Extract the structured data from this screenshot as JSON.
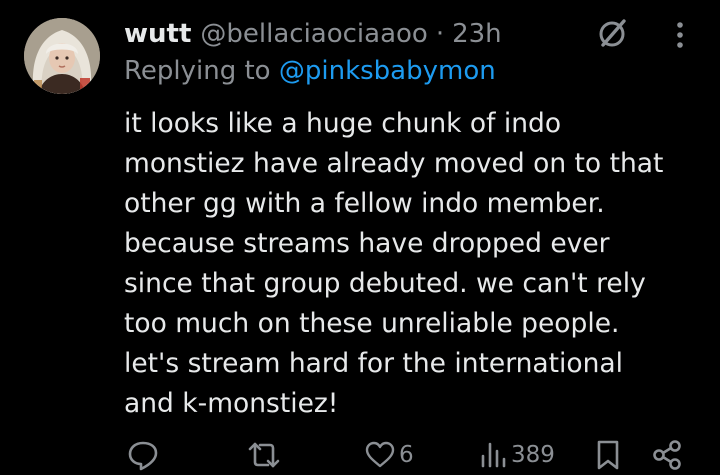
{
  "tweet": {
    "author": {
      "display_name": "wutt",
      "handle": "@bellaciaociaaoo",
      "separator": "·",
      "time": "23h",
      "avatar_icon": "profile-photo"
    },
    "reply": {
      "prefix": "Replying to",
      "mention": "@pinksbabymon"
    },
    "text_lines": [
      "it looks like a huge chunk of indo",
      "monstiez have already moved on to that",
      "other gg with a fellow indo member.",
      "because streams have dropped ever",
      "since that group debuted. we can't rely",
      "too much on these unreliable people.",
      "let's stream hard for the international",
      "and k-monstiez!"
    ],
    "actions": {
      "reply_icon": "reply-bubble",
      "retweet_icon": "retweet-arrows",
      "like_icon": "heart",
      "like_count": "6",
      "views_icon": "bar-chart",
      "views_count": "389",
      "bookmark_icon": "bookmark",
      "share_icon": "share-nodes"
    },
    "top_icons": {
      "grok": "grok-slash-circle",
      "more": "vertical-ellipsis"
    }
  },
  "colors": {
    "background": "#000000",
    "primary_text": "#e7e9ea",
    "secondary_text": "#8b8f94",
    "link": "#1d9bf0"
  }
}
